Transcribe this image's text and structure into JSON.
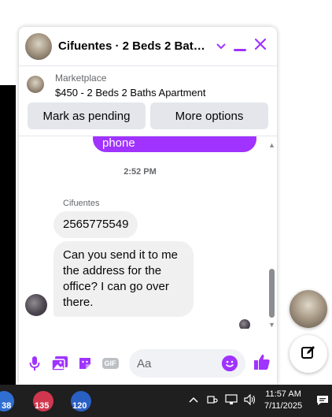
{
  "chat": {
    "title": "Cifuentes · 2 Beds 2 Baths ...",
    "marketplace_label": "Marketplace",
    "listing_title": "$450 - 2 Beds 2 Baths Apartment",
    "mark_pending_label": "Mark as pending",
    "more_options_label": "More options",
    "sent_partial_text": "phone",
    "timestamp": "2:52 PM",
    "sender_name": "Cifuentes",
    "message_phone": "2565775549",
    "message_address": "Can you send it to me the address for the office? I can go over there.",
    "input_placeholder": "Aa",
    "accent_color": "#a033ff",
    "icons": [
      "microphone-icon",
      "image-icon",
      "sticker-icon",
      "gif-icon",
      "emoji-icon",
      "thumbs-up-icon",
      "chevron-down-icon",
      "minimize-icon",
      "close-icon",
      "compose-icon"
    ]
  },
  "taskbar": {
    "apps": [
      {
        "badge": "38",
        "color": "#2f6fd1"
      },
      {
        "badge": "135",
        "color": "#d0374e"
      },
      {
        "badge": "120",
        "color": "#2a5fc4"
      }
    ],
    "time": "11:57 AM",
    "date": "7/11/2025"
  }
}
